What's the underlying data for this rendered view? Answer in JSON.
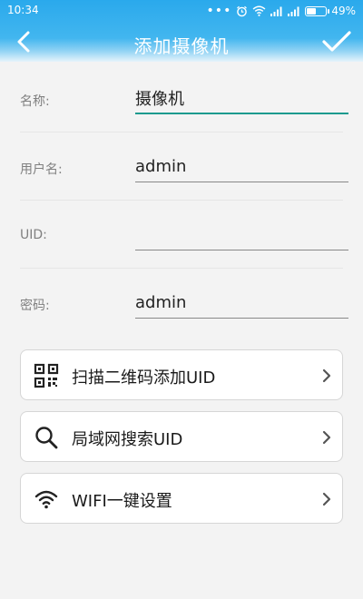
{
  "status_bar": {
    "time": "10:34",
    "dots": "•••",
    "battery": "49%",
    "battery_level": 0.49
  },
  "header": {
    "title": "添加摄像机",
    "back_icon": "chevron-left-icon",
    "confirm_icon": "checkmark-icon"
  },
  "form": {
    "fields": [
      {
        "label": "名称:",
        "value": "摄像机",
        "placeholder": ""
      },
      {
        "label": "用户名:",
        "value": "admin",
        "placeholder": ""
      },
      {
        "label": "UID:",
        "value": "",
        "placeholder": ""
      },
      {
        "label": "密码:",
        "value": "admin",
        "placeholder": ""
      }
    ]
  },
  "actions": [
    {
      "label": "扫描二维码添加UID",
      "icon": "qr-code-icon"
    },
    {
      "label": "局域网搜索UID",
      "icon": "search-icon"
    },
    {
      "label": "WIFI一键设置",
      "icon": "wifi-icon"
    }
  ],
  "colors": {
    "header": "#2aa9ec",
    "accent": "#1a9a8e",
    "background": "#f3f3f3"
  }
}
